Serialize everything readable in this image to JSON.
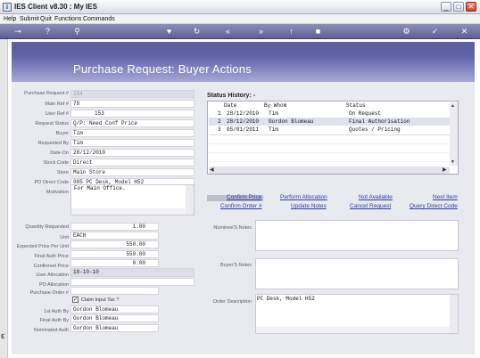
{
  "window": {
    "title": "IES Client v8.30 : My IES",
    "min": "_",
    "max": "□",
    "close": "✕"
  },
  "menu": [
    "Help",
    "Submit",
    "Quit",
    "Functions",
    "Commands"
  ],
  "header": {
    "title": "Purchase Request: Buyer Actions"
  },
  "form": {
    "purchase_request_label": "Purchase Request #",
    "purchase_request_value": "154",
    "main_ref_label": "Main Ref #",
    "main_ref_value": "78",
    "user_ref_label": "User Ref #",
    "user_ref_value": "153",
    "request_status_label": "Request Status",
    "request_status_value": "Q/P: Need Conf Price",
    "buyer_label": "Buyer",
    "buyer_value": "Tim",
    "requested_by_label": "Requested By",
    "requested_by_value": "Tim",
    "date_on_label": "Date-On",
    "date_on_value": "28/12/2010",
    "stock_code_label": "Stock Code",
    "stock_code_value": "Direct",
    "store_label": "Store",
    "store_value": "Main Store",
    "po_direct_code_label": "PO Direct Code",
    "po_direct_code_value": "085 PC Desk, Model H52",
    "motivation_label": "Motivation",
    "motivation_value": "For Main Office.",
    "quantity_requested_label": "Quantity Requested",
    "quantity_requested_value": "1.00",
    "unit_label": "Unit",
    "unit_value": "EACH",
    "expected_price_label": "Expected Price Per Unit",
    "expected_price_value": "550.00",
    "final_auth_price_label": "Final Auth Price",
    "final_auth_price_value": "550.00",
    "confirmed_price_label": "Confirmed Price",
    "confirmed_price_value": "0.00",
    "user_allocation_label": "User Allocation",
    "user_allocation_value": "10-10-10",
    "po_allocation_label": "PO Allocation",
    "po_allocation_value": "",
    "purchase_order_label": "Purchase Order #",
    "purchase_order_value": "",
    "claim_input_tax_label": "Claim Input Tax ?",
    "claim_input_tax_checked": "✓",
    "first_auth_by_label": "1st Auth By",
    "first_auth_by_value": "Gordon Blomeau",
    "final_auth_by_label": "Final Auth By",
    "final_auth_by_value": "Gordon Blomeau",
    "nominated_auth_label": "Nominated Auth",
    "nominated_auth_value": "Gordon Blomeau"
  },
  "status_history": {
    "title": "Status History: -",
    "columns": [
      "Date",
      "By Whom",
      "Status"
    ],
    "rows": [
      {
        "n": "1",
        "date": "28/12/2010",
        "by": "Tim",
        "status": "On Request"
      },
      {
        "n": "2",
        "date": "28/12/2010",
        "by": "Gordon Blomeau",
        "status": "Final Authorisation"
      },
      {
        "n": "3",
        "date": "05/01/2011",
        "by": "Tim",
        "status": "Quotes / Pricing"
      }
    ]
  },
  "actions": {
    "confirm_price": "Confirm Price",
    "perform_allocation": "Perform Allocation",
    "not_available": "Not Available",
    "next_item": "Next Item",
    "confirm_order": "Confirm Order #",
    "update_notes": "Update Notes",
    "cancel_request": "Cancel Request",
    "query_direct_code": "Query Direct Code"
  },
  "notes": {
    "nominee_label": "Nominee'S Notes",
    "nominee_value": "",
    "buyer_label": "Buyer'S Notes",
    "buyer_value": "",
    "order_desc_label": "Order Description",
    "order_desc_value": "PC Desk, Model H52"
  }
}
